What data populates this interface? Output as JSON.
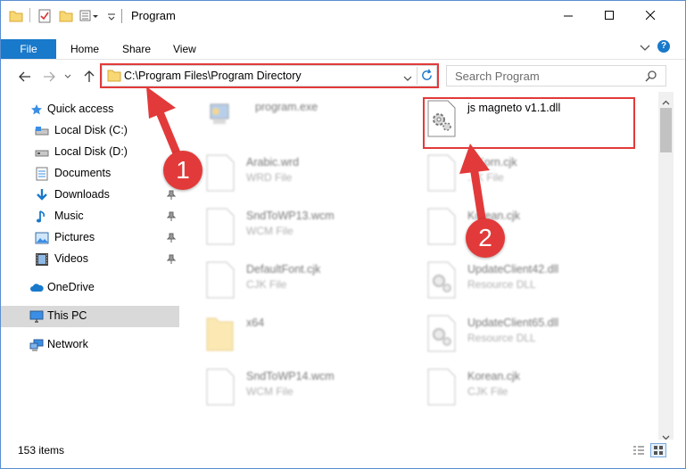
{
  "window": {
    "title": "Program"
  },
  "ribbon": {
    "tabs": [
      "File",
      "Home",
      "Share",
      "View"
    ]
  },
  "address": {
    "path": "C:\\Program Files\\Program Directory"
  },
  "search": {
    "placeholder": "Search Program"
  },
  "nav": {
    "items": [
      {
        "label": "Quick access",
        "icon": "star-icon",
        "pinned": false
      },
      {
        "label": "Local Disk (C:)",
        "icon": "drive-icon",
        "pinned": false
      },
      {
        "label": "Local Disk (D:)",
        "icon": "drive-icon",
        "pinned": false
      },
      {
        "label": "Documents",
        "icon": "documents-icon",
        "pinned": false
      },
      {
        "label": "Downloads",
        "icon": "downloads-icon",
        "pinned": true
      },
      {
        "label": "Music",
        "icon": "music-icon",
        "pinned": true
      },
      {
        "label": "Pictures",
        "icon": "pictures-icon",
        "pinned": true
      },
      {
        "label": "Videos",
        "icon": "videos-icon",
        "pinned": true
      },
      {
        "label": "OneDrive",
        "icon": "cloud-icon",
        "pinned": false
      },
      {
        "label": "This PC",
        "icon": "computer-icon",
        "pinned": false,
        "selected": true
      },
      {
        "label": "Network",
        "icon": "network-icon",
        "pinned": false
      }
    ]
  },
  "files": {
    "left": [
      {
        "name": "program.exe",
        "type": ""
      },
      {
        "name": "Arabic.wrd",
        "type": "WRD File"
      },
      {
        "name": "SndToWP13.wcm",
        "type": "WCM File"
      },
      {
        "name": "DefaultFont.cjk",
        "type": "CJK File"
      },
      {
        "name": "x64",
        "type": ""
      },
      {
        "name": "SndToWP14.wcm",
        "type": "WCM File"
      }
    ],
    "right": [
      {
        "name": "js magneto v1.1.dll",
        "type": ""
      },
      {
        "name": "...Korn.cjk",
        "type": "...K File"
      },
      {
        "name": "Korean.cjk",
        "type": ""
      },
      {
        "name": "UpdateClient42.dll",
        "type": "Resource DLL"
      },
      {
        "name": "UpdateClient65.dll",
        "type": "Resource DLL"
      },
      {
        "name": "Korean.cjk",
        "type": "CJK File"
      }
    ]
  },
  "status": {
    "items": "153 items"
  },
  "annotations": {
    "step1": "1",
    "step2": "2"
  },
  "colors": {
    "accent": "#1979ca",
    "highlight": "#e23a3a"
  }
}
